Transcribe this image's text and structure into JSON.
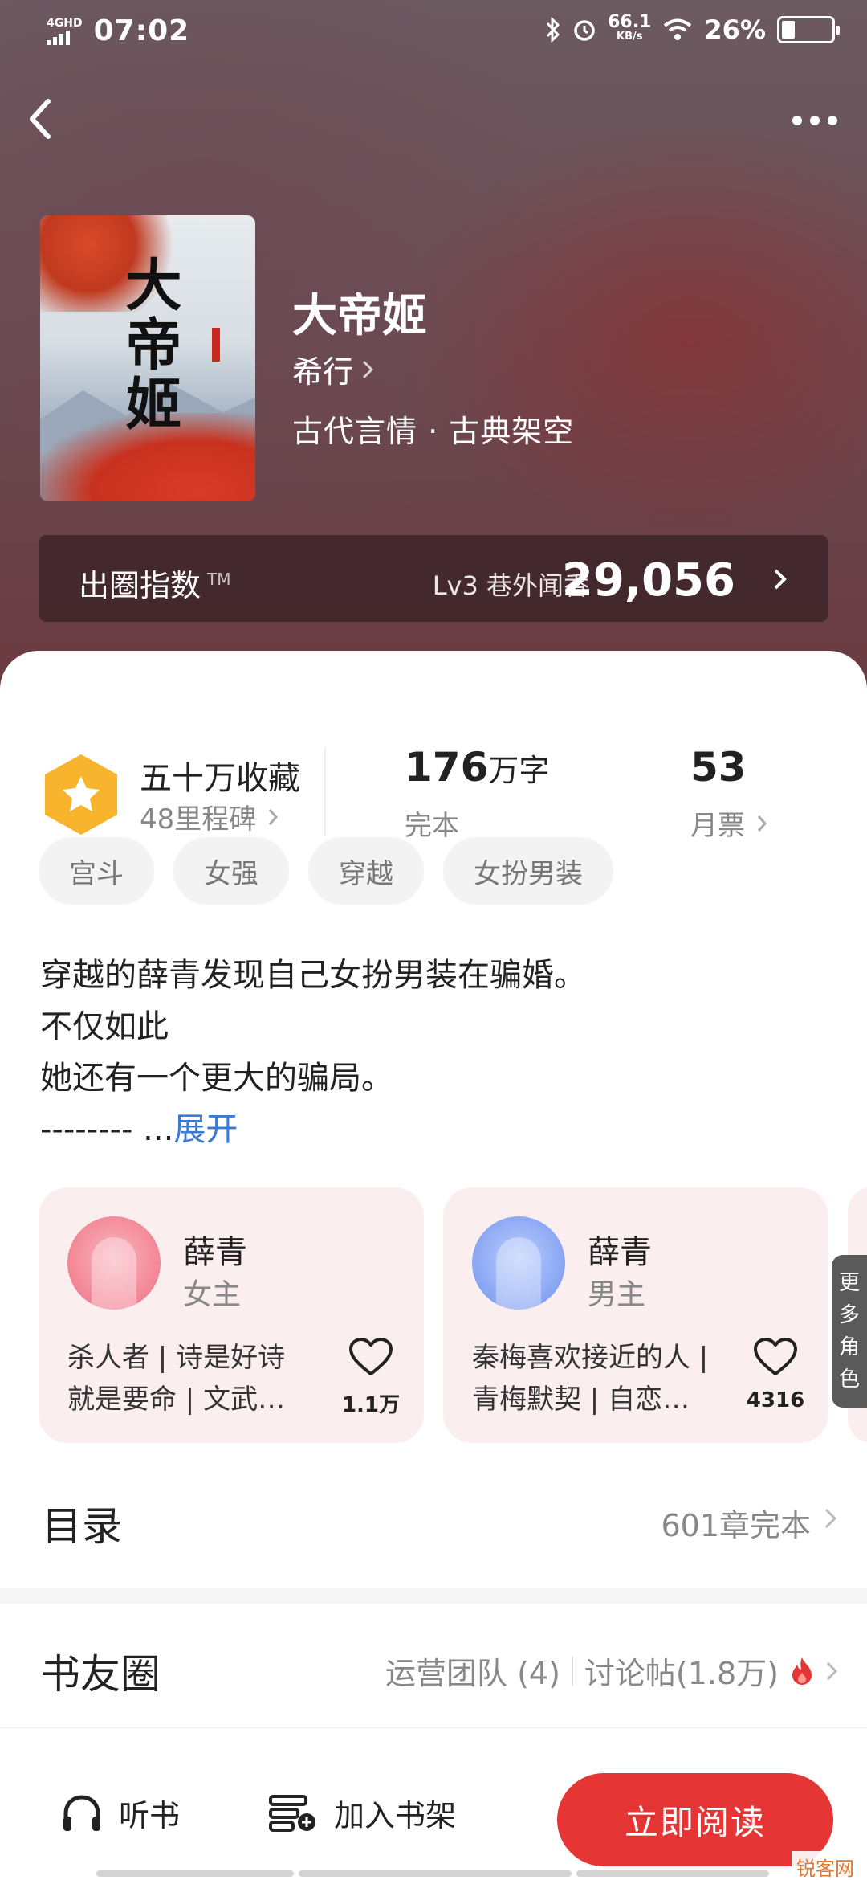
{
  "status_bar": {
    "network": "4GHD",
    "time": "07:02",
    "speed_value": "66.1",
    "speed_unit": "KB/s",
    "battery": "26%"
  },
  "book": {
    "title": "大帝姬",
    "cover_title": "大帝姬",
    "author": "希行",
    "genre": "古代言情 · 古典架空"
  },
  "heat": {
    "label": "出圈指数",
    "tm": "TM",
    "level": "Lv3 巷外闻香",
    "score": "29,056"
  },
  "stats": {
    "collect_title": "五十万收藏",
    "collect_sub": "48里程碑",
    "words_value": "176",
    "words_unit": "万字",
    "words_sub": "完本",
    "tickets_value": "53",
    "tickets_sub": "月票"
  },
  "tags": [
    "宫斗",
    "女强",
    "穿越",
    "女扮男装"
  ],
  "description": {
    "line1": "穿越的薛青发现自己女扮男装在骗婚。",
    "line2": "不仅如此",
    "line3": "她还有一个更大的骗局。",
    "line4": "-------- ...",
    "expand": "展开"
  },
  "characters": [
    {
      "name": "薛青",
      "role": "女主",
      "desc_line1": "杀人者 | 诗是好诗",
      "desc_line2": "就是要命 | 文武…",
      "likes": "1.1万"
    },
    {
      "name": "薛青",
      "role": "男主",
      "desc_line1": "秦梅喜欢接近的人 |",
      "desc_line2": "青梅默契 | 自恋…",
      "likes": "4316"
    }
  ],
  "more_roles": [
    "更",
    "多",
    "角",
    "色"
  ],
  "toc": {
    "title": "目录",
    "info": "601章完本"
  },
  "circle": {
    "title": "书友圈",
    "team": "运营团队 (4)",
    "posts": "讨论帖(1.8万)"
  },
  "bottom_bar": {
    "listen": "听书",
    "add_shelf": "加入书架",
    "read": "立即阅读"
  },
  "watermark": "锐客网",
  "colors": {
    "accent": "#e53535",
    "link": "#3a7bd5",
    "card_bg": "#fbeeee",
    "badge": "#f7b42c"
  }
}
